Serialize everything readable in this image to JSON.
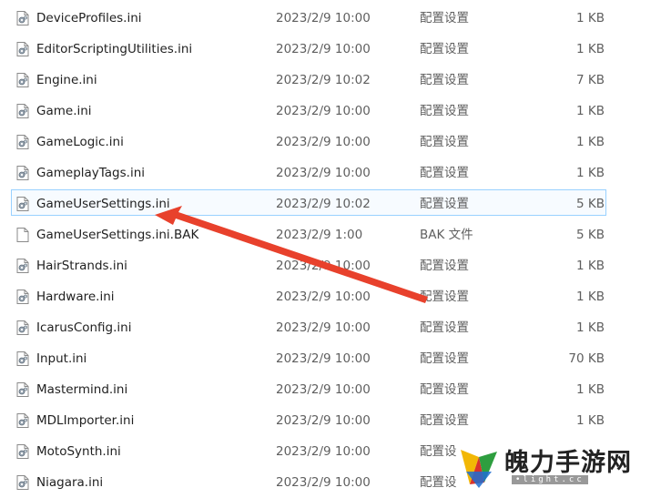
{
  "files": [
    {
      "name": "DeviceProfiles.ini",
      "date": "2023/2/9 10:00",
      "type": "配置设置",
      "size": "1 KB",
      "icon": "settings-file-icon"
    },
    {
      "name": "EditorScriptingUtilities.ini",
      "date": "2023/2/9 10:00",
      "type": "配置设置",
      "size": "1 KB",
      "icon": "settings-file-icon"
    },
    {
      "name": "Engine.ini",
      "date": "2023/2/9 10:02",
      "type": "配置设置",
      "size": "7 KB",
      "icon": "settings-file-icon"
    },
    {
      "name": "Game.ini",
      "date": "2023/2/9 10:00",
      "type": "配置设置",
      "size": "1 KB",
      "icon": "settings-file-icon"
    },
    {
      "name": "GameLogic.ini",
      "date": "2023/2/9 10:00",
      "type": "配置设置",
      "size": "1 KB",
      "icon": "settings-file-icon"
    },
    {
      "name": "GameplayTags.ini",
      "date": "2023/2/9 10:00",
      "type": "配置设置",
      "size": "1 KB",
      "icon": "settings-file-icon"
    },
    {
      "name": "GameUserSettings.ini",
      "date": "2023/2/9 10:02",
      "type": "配置设置",
      "size": "5 KB",
      "icon": "settings-file-icon",
      "selected": true
    },
    {
      "name": "GameUserSettings.ini.BAK",
      "date": "2023/2/9 1:00",
      "type": "BAK 文件",
      "size": "5 KB",
      "icon": "blank-file-icon"
    },
    {
      "name": "HairStrands.ini",
      "date": "2023/2/9 10:00",
      "type": "配置设置",
      "size": "1 KB",
      "icon": "settings-file-icon"
    },
    {
      "name": "Hardware.ini",
      "date": "2023/2/9 10:00",
      "type": "配置设置",
      "size": "1 KB",
      "icon": "settings-file-icon"
    },
    {
      "name": "IcarusConfig.ini",
      "date": "2023/2/9 10:00",
      "type": "配置设置",
      "size": "1 KB",
      "icon": "settings-file-icon"
    },
    {
      "name": "Input.ini",
      "date": "2023/2/9 10:00",
      "type": "配置设置",
      "size": "70 KB",
      "icon": "settings-file-icon"
    },
    {
      "name": "Mastermind.ini",
      "date": "2023/2/9 10:00",
      "type": "配置设置",
      "size": "1 KB",
      "icon": "settings-file-icon"
    },
    {
      "name": "MDLImporter.ini",
      "date": "2023/2/9 10:00",
      "type": "配置设置",
      "size": "1 KB",
      "icon": "settings-file-icon"
    },
    {
      "name": "MotoSynth.ini",
      "date": "2023/2/9 10:00",
      "type": "配置设",
      "size": "",
      "icon": "settings-file-icon"
    },
    {
      "name": "Niagara.ini",
      "date": "2023/2/9 10:00",
      "type": "配置设",
      "size": "",
      "icon": "settings-file-icon"
    }
  ],
  "annotation": {
    "color": "#e8412c",
    "icon": "red-arrow-icon"
  },
  "watermark": {
    "text": "魄力手游网",
    "subtext": "•light.cc",
    "icon": "watermark-logo-icon"
  },
  "colors": {
    "selection_border": "#99d1ff",
    "selection_fill": "#f7fbff"
  }
}
